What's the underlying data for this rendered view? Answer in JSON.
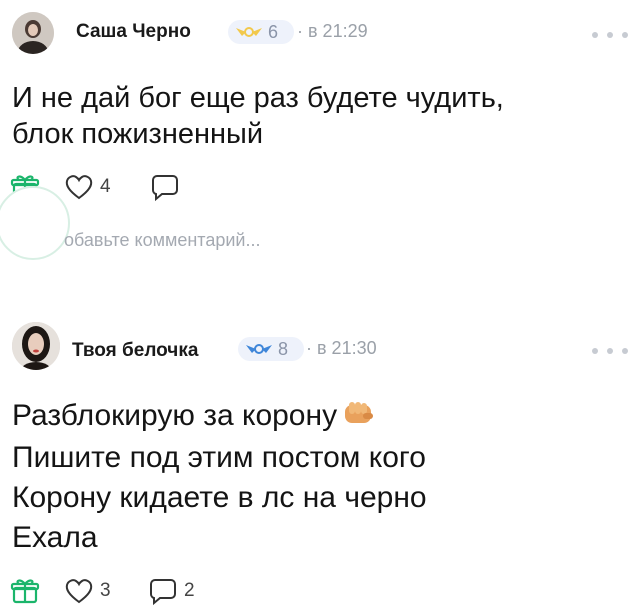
{
  "posts": [
    {
      "author": "Саша Черно",
      "level": "6",
      "time": "· в 21:29",
      "text_lines": [
        "И не дай бог еще раз будете чудить,",
        "блок пожизненный"
      ],
      "likes": "4",
      "comments": "",
      "comment_placeholder": "обавьте комментарий..."
    },
    {
      "author": "Твоя белочка",
      "level": "8",
      "time": "· в 21:30",
      "text_lines": [
        "Разблокирую за корону",
        "Пишите под этим постом кого",
        "Корону кидаете в лс на черно",
        "Ехала"
      ],
      "likes": "3",
      "comments": "2"
    }
  ],
  "colors": {
    "badge_icon": "#f2c94c",
    "badge_icon_2": "#3f86d9",
    "accent_green": "#1bb56b"
  },
  "icons": [
    "gift-icon",
    "heart-icon",
    "comment-icon",
    "more-icon",
    "level-wings-icon",
    "fist-emoji"
  ]
}
